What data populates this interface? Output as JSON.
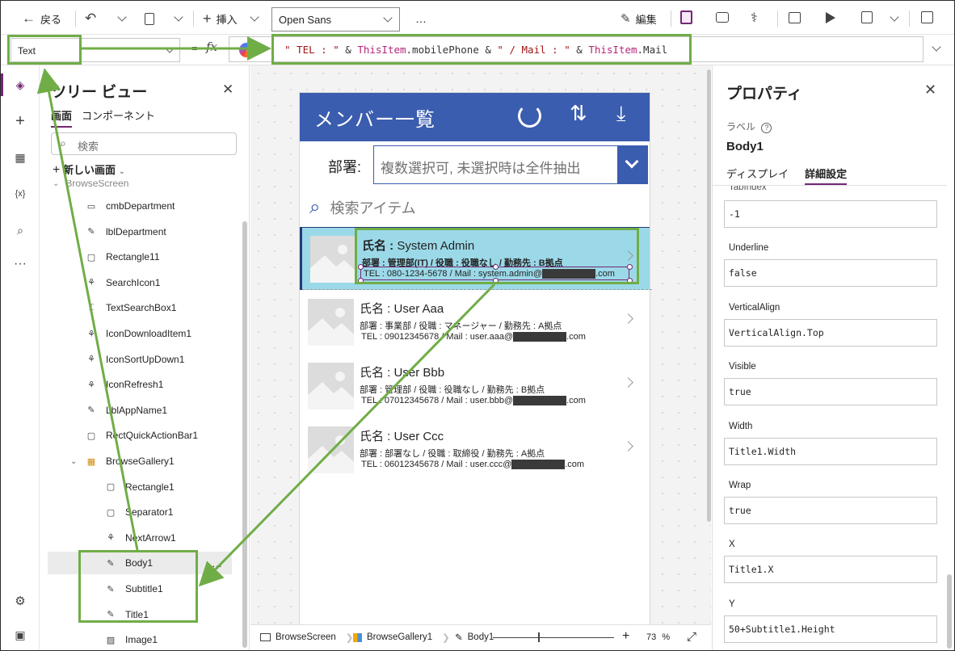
{
  "commandbar": {
    "back_label": "戻る",
    "insert_label": "挿入",
    "font_value": "Open Sans",
    "more_label": "…",
    "edit_label": "編集"
  },
  "formulabar": {
    "property_value": "Text",
    "fx_label": "fx",
    "formula_parts": [
      {
        "text": "\" TEL : \"",
        "kind": "str"
      },
      {
        "text": " & ",
        "kind": "op"
      },
      {
        "text": "ThisItem",
        "kind": "kw"
      },
      {
        "text": ".mobilePhone & ",
        "kind": "op"
      },
      {
        "text": "\" / Mail : \"",
        "kind": "str"
      },
      {
        "text": " & ",
        "kind": "op"
      },
      {
        "text": "ThisItem",
        "kind": "kw"
      },
      {
        "text": ".Mail",
        "kind": "op"
      }
    ]
  },
  "tree": {
    "title": "ツリー ビュー",
    "tab_screens": "画面",
    "tab_components": "コンポーネント",
    "search_placeholder": "検索",
    "new_screen": "新しい画面",
    "partial_item": "BrowseScreen",
    "items": [
      {
        "label": "cmbDepartment",
        "icon": "combobox-icon"
      },
      {
        "label": "lblDepartment",
        "icon": "label-icon"
      },
      {
        "label": "Rectangle11",
        "icon": "rectangle-icon"
      },
      {
        "label": "SearchIcon1",
        "icon": "icon-control-icon"
      },
      {
        "label": "TextSearchBox1",
        "icon": "textinput-icon"
      },
      {
        "label": "IconDownloadItem1",
        "icon": "icon-control-icon"
      },
      {
        "label": "IconSortUpDown1",
        "icon": "icon-control-icon"
      },
      {
        "label": "IconRefresh1",
        "icon": "icon-control-icon"
      },
      {
        "label": "LblAppName1",
        "icon": "label-icon"
      },
      {
        "label": "RectQuickActionBar1",
        "icon": "rectangle-icon"
      },
      {
        "label": "BrowseGallery1",
        "icon": "gallery-icon"
      },
      {
        "label": "Rectangle1",
        "icon": "rectangle-icon"
      },
      {
        "label": "Separator1",
        "icon": "rectangle-icon"
      },
      {
        "label": "NextArrow1",
        "icon": "icon-control-icon"
      },
      {
        "label": "Body1",
        "icon": "label-icon"
      },
      {
        "label": "Subtitle1",
        "icon": "label-icon"
      },
      {
        "label": "Title1",
        "icon": "label-icon"
      },
      {
        "label": "Image1",
        "icon": "image-icon"
      }
    ],
    "selected_more": "…"
  },
  "app": {
    "title": "メンバー一覧",
    "dept_label": "部署:",
    "dept_placeholder": "複数選択可, 未選択時は全件抽出",
    "search_placeholder": "検索アイテム",
    "gallery": [
      {
        "title_label": "氏名 : ",
        "title_value": "System Admin",
        "subtitle": "部署 : 管理部(IT) / 役職 : 役職なし / 勤務先 : B拠点",
        "body_prefix": "TEL : 080-1234-5678 / Mail : system.admin@",
        "body_suffix": ".com"
      },
      {
        "title_label": "氏名 : ",
        "title_value": "User Aaa",
        "subtitle": "部署 : 事業部 / 役職 : マネージャー / 勤務先 : A拠点",
        "body_prefix": "TEL : 09012345678 / Mail : user.aaa@",
        "body_suffix": ".com"
      },
      {
        "title_label": "氏名 : ",
        "title_value": "User Bbb",
        "subtitle": "部署 : 管理部 / 役職 : 役職なし / 勤務先 : B拠点",
        "body_prefix": "TEL : 07012345678 / Mail : user.bbb@",
        "body_suffix": ".com"
      },
      {
        "title_label": "氏名 : ",
        "title_value": "User Ccc",
        "subtitle": "部署 : 部署なし / 役職 : 取締役 / 勤務先 : A拠点",
        "body_prefix": "TEL : 06012345678 / Mail : user.ccc@",
        "body_suffix": ".com"
      }
    ]
  },
  "statusbar": {
    "crumb_screen": "BrowseScreen",
    "crumb_gallery": "BrowseGallery1",
    "crumb_body": "Body1",
    "zoom_value": "73",
    "zoom_unit": "%"
  },
  "props": {
    "title": "プロパティ",
    "kind_label": "ラベル",
    "control_name": "Body1",
    "tab_display": "ディスプレイ",
    "tab_advanced": "詳細設定",
    "partial_label": "TabIndex",
    "fields": [
      {
        "label": "",
        "value": "-1"
      },
      {
        "label": "Underline",
        "value": "false"
      },
      {
        "label": "VerticalAlign",
        "value": "VerticalAlign.Top"
      },
      {
        "label": "Visible",
        "value": "true"
      },
      {
        "label": "Width",
        "value": "Title1.Width"
      },
      {
        "label": "Wrap",
        "value": "true"
      },
      {
        "label": "X",
        "value": "Title1.X"
      },
      {
        "label": "Y",
        "value": "50+Subtitle1.Height"
      }
    ]
  },
  "colors": {
    "accent": "#742774",
    "app_header": "#3b5daf",
    "selected_row": "#9bd9e8",
    "annotation": "#70ad47"
  }
}
